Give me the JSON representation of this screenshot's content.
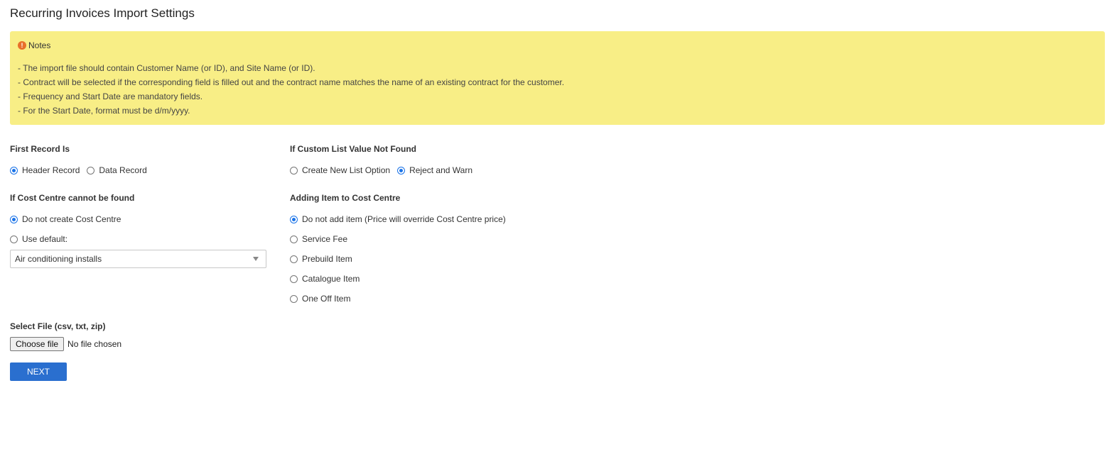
{
  "page": {
    "title": "Recurring Invoices Import Settings"
  },
  "notes": {
    "title": "Notes",
    "icon": "warning-icon",
    "lines": [
      "- The import file should contain Customer Name (or ID), and Site Name (or ID).",
      "- Contract will be selected if the corresponding field is filled out and the contract name matches the name of an existing contract for the customer.",
      "- Frequency and Start Date are mandatory fields.",
      "- For the Start Date, format must be d/m/yyyy."
    ]
  },
  "first_record": {
    "label": "First Record Is",
    "options": [
      "Header Record",
      "Data Record"
    ],
    "selected": "Header Record"
  },
  "custom_list": {
    "label": "If Custom List Value Not Found",
    "options": [
      "Create New List Option",
      "Reject and Warn"
    ],
    "selected": "Reject and Warn"
  },
  "cost_centre": {
    "label": "If Cost Centre cannot be found",
    "options": [
      "Do not create Cost Centre",
      "Use default:"
    ],
    "selected": "Do not create Cost Centre",
    "default_select_value": "Air conditioning installs"
  },
  "adding_item": {
    "label": "Adding Item to Cost Centre",
    "options": [
      "Do not add item (Price will override Cost Centre price)",
      "Service Fee",
      "Prebuild Item",
      "Catalogue Item",
      "One Off Item"
    ],
    "selected": "Do not add item (Price will override Cost Centre price)"
  },
  "file": {
    "label": "Select File (csv, txt, zip)",
    "button": "Choose file",
    "status": "No file chosen"
  },
  "next_button": "NEXT",
  "colors": {
    "notes_bg": "#f8ee86",
    "accent": "#1a73e8",
    "button": "#2a6fcf",
    "warn": "#e8702a"
  }
}
